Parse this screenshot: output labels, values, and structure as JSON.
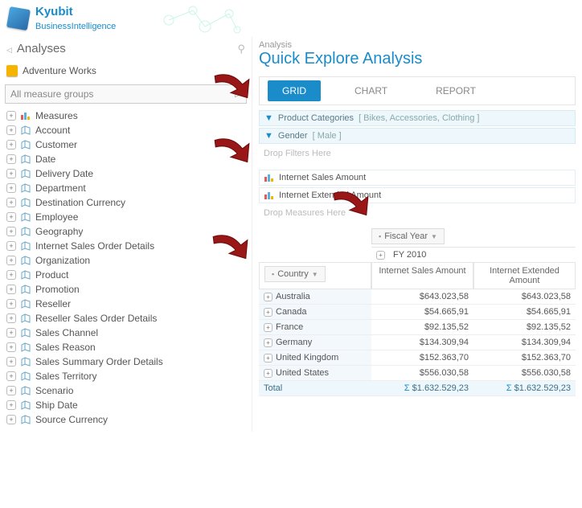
{
  "brand": {
    "line1": "Kyubit",
    "line2": "BusinessIntelligence"
  },
  "sidebar": {
    "title": "Analyses",
    "cube": "Adventure Works",
    "measure_group_placeholder": "All measure groups",
    "items": [
      {
        "label": "Measures",
        "icon": "bars"
      },
      {
        "label": "Account",
        "icon": "dim"
      },
      {
        "label": "Customer",
        "icon": "dim"
      },
      {
        "label": "Date",
        "icon": "dim"
      },
      {
        "label": "Delivery Date",
        "icon": "dim"
      },
      {
        "label": "Department",
        "icon": "dim"
      },
      {
        "label": "Destination Currency",
        "icon": "dim"
      },
      {
        "label": "Employee",
        "icon": "dim"
      },
      {
        "label": "Geography",
        "icon": "dim"
      },
      {
        "label": "Internet Sales Order Details",
        "icon": "dim"
      },
      {
        "label": "Organization",
        "icon": "dim"
      },
      {
        "label": "Product",
        "icon": "dim"
      },
      {
        "label": "Promotion",
        "icon": "dim"
      },
      {
        "label": "Reseller",
        "icon": "dim"
      },
      {
        "label": "Reseller Sales Order Details",
        "icon": "dim"
      },
      {
        "label": "Sales Channel",
        "icon": "dim"
      },
      {
        "label": "Sales Reason",
        "icon": "dim"
      },
      {
        "label": "Sales Summary Order Details",
        "icon": "dim"
      },
      {
        "label": "Sales Territory",
        "icon": "dim"
      },
      {
        "label": "Scenario",
        "icon": "dim"
      },
      {
        "label": "Ship Date",
        "icon": "dim"
      },
      {
        "label": "Source Currency",
        "icon": "dim"
      }
    ]
  },
  "analysis": {
    "breadcrumb": "Analysis",
    "title": "Quick Explore Analysis",
    "tabs": {
      "grid": "GRID",
      "chart": "CHART",
      "report": "REPORT"
    },
    "filters": [
      {
        "name": "Product Categories",
        "values": "[ Bikes, Accessories, Clothing ]"
      },
      {
        "name": "Gender",
        "values": "[ Male ]"
      }
    ],
    "drop_filters": "Drop Filters Here",
    "measures": [
      "Internet Sales Amount",
      "Internet Extended Amount"
    ],
    "drop_measures": "Drop Measures Here",
    "col_dim": "Fiscal Year",
    "col_member": "FY 2010",
    "row_dim": "Country",
    "col_headers": [
      "Internet Sales Amount",
      "Internet Extended Amount"
    ],
    "rows": [
      {
        "label": "Australia",
        "v1": "$643.023,58",
        "v2": "$643.023,58"
      },
      {
        "label": "Canada",
        "v1": "$54.665,91",
        "v2": "$54.665,91"
      },
      {
        "label": "France",
        "v1": "$92.135,52",
        "v2": "$92.135,52"
      },
      {
        "label": "Germany",
        "v1": "$134.309,94",
        "v2": "$134.309,94"
      },
      {
        "label": "United Kingdom",
        "v1": "$152.363,70",
        "v2": "$152.363,70"
      },
      {
        "label": "United States",
        "v1": "$556.030,58",
        "v2": "$556.030,58"
      }
    ],
    "total": {
      "label": "Total",
      "v1": "$1.632.529,23",
      "v2": "$1.632.529,23"
    }
  }
}
